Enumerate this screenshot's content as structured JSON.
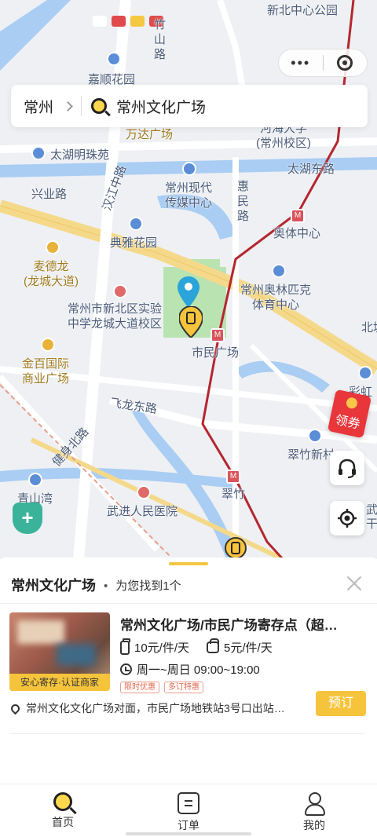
{
  "map": {
    "labels": {
      "xinbei_park": "新北中心公园",
      "jiashun": "嘉顺花园",
      "zhushan_road": "竹山路",
      "wanda": "万达广场",
      "hehai": "河海大学\n(常州校区)",
      "taihu_pearl": "太湖明珠苑",
      "media_center": "常州现代\n传媒中心",
      "huimin_road": "惠民路",
      "taihu_east_road": "太湖东路",
      "xingye_road": "兴业路",
      "hanjiang_road": "汉江中路",
      "dianya": "典雅花园",
      "sports_center": "奥体中心",
      "mcdonalds": "麦德龙\n(龙城大道)",
      "olympic": "常州奥林匹克\n体育中心",
      "school": "常州市新北区实验\n中学龙城大道校区",
      "citizen_square": "市民广场",
      "jinbai": "金百国际\n商业广场",
      "beijiang": "北塘",
      "caihong": "彩虹",
      "feilong_road": "飞龙东路",
      "jianshen_road": "健身北路",
      "cuizhu_xincun": "翠竹新村",
      "cuizhu": "翠竹",
      "qingshanwan": "青山湾",
      "wujin_hospital": "武进人民医院",
      "wu": "武",
      "gan": "干"
    },
    "coupon_label": "领券",
    "colors": {
      "road_major": "#f5d98a",
      "road": "#ffffff",
      "water": "#a9cdf3",
      "green": "#b9e3b0",
      "metro": "#b5262e"
    }
  },
  "capsule": {
    "more": "•••"
  },
  "search": {
    "city": "常州",
    "value": "常州文化广场"
  },
  "sheet": {
    "title": "常州文化广场",
    "count": "为您找到1个"
  },
  "result": {
    "title": "常州文化广场/市民广场寄存点（超…",
    "badge": "安心寄存·认证商家",
    "price_luggage": "10元/件/天",
    "price_bag": "5元/件/天",
    "hours": "周一~周日 09:00~19:00",
    "tags": [
      "限时优惠",
      "多订特惠"
    ],
    "address": "常州文化文化广场对面，市民广场地铁站3号口出站…",
    "book_label": "预订"
  },
  "tabs": [
    {
      "label": "首页",
      "icon": "search-icon"
    },
    {
      "label": "订单",
      "icon": "order-icon"
    },
    {
      "label": "我的",
      "icon": "user-icon"
    }
  ]
}
